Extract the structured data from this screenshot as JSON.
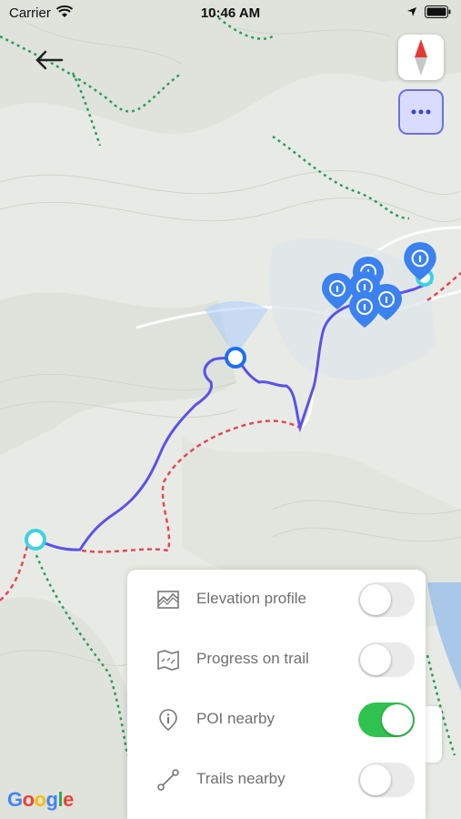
{
  "status_bar": {
    "carrier": "Carrier",
    "time": "10:46 AM"
  },
  "map": {
    "attribution": "Google"
  },
  "options_panel": {
    "items": [
      {
        "label": "Elevation profile",
        "enabled": false,
        "icon": "elevation-icon"
      },
      {
        "label": "Progress on trail",
        "enabled": false,
        "icon": "map-progress-icon"
      },
      {
        "label": "POI nearby",
        "enabled": true,
        "icon": "poi-pin-icon"
      },
      {
        "label": "Trails nearby",
        "enabled": false,
        "icon": "trail-route-icon"
      }
    ]
  },
  "colors": {
    "route": "#5b52e8",
    "poi": "#3b82f0",
    "toggle_on": "#30c24f",
    "more_button_bg": "#d9dcff"
  }
}
